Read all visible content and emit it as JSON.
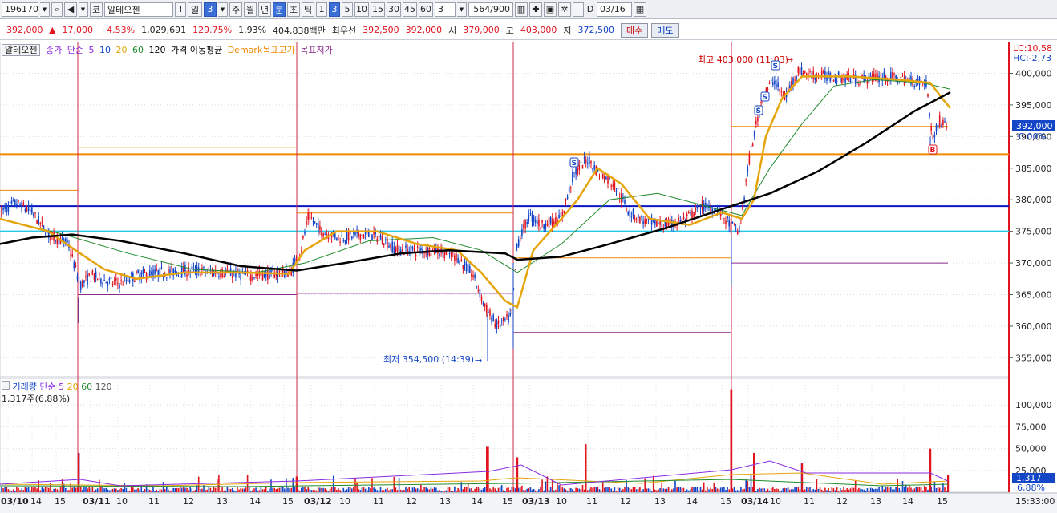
{
  "toolbar": {
    "code": "196170",
    "market": "코",
    "name": "알테오젠",
    "period_day": "일",
    "period_num": "3",
    "period_week": "주",
    "period_month": "월",
    "period_year": "년",
    "period_min": "분",
    "period_sec": "초",
    "period_tick": "틱",
    "intervals": [
      "1",
      "3",
      "5",
      "10",
      "15",
      "30",
      "45",
      "60"
    ],
    "interval_input": "3",
    "count": "564",
    "count_max": "/900",
    "d_label": "D",
    "date": "03/16"
  },
  "quote": {
    "price": "392,000",
    "change": "17,000",
    "change_pct": "+4.53%",
    "volume": "1,029,691",
    "volume_ratio": "129.75%",
    "turnover": "1.93%",
    "amount": "404,838백만",
    "best_label": "최우선",
    "best_ask": "392,500",
    "best_bid": "392,000",
    "open_label": "시",
    "open": "379,000",
    "high_label": "고",
    "high": "403,000",
    "low_label": "저",
    "low": "372,500",
    "buy": "매수",
    "sell": "매도"
  },
  "legend": {
    "name": "알테오젠",
    "close": "종가",
    "simple": "단순",
    "ma": [
      "5",
      "10",
      "20",
      "60",
      "120"
    ],
    "price_ma": "가격 이동평균",
    "demark_high": "Demark목표고가",
    "demark_low": "목표저가"
  },
  "vol_legend": {
    "name": "거래량",
    "simple": "단순",
    "ma": [
      "5",
      "20",
      "60",
      "120"
    ],
    "current": "1,317주(6,88%)"
  },
  "annotations": {
    "high": "최고 403,000 (11:03)",
    "low": "최저 354,500 (14:39)",
    "lc": "LC:10,58",
    "hc": "HC:-2,73",
    "last_price": "392,000",
    "last_pct": "0.00%",
    "vol_last": "1,317",
    "vol_pct": "6,88%",
    "time": "15:33:00"
  },
  "price_axis": [
    "400,000",
    "395,000",
    "390,000",
    "385,000",
    "380,000",
    "375,000",
    "370,000",
    "365,000",
    "360,000",
    "355,000"
  ],
  "volume_axis": [
    "100,000",
    "75,000",
    "50,000",
    "25,000"
  ],
  "time_axis": [
    {
      "label": "03/10",
      "day": true
    },
    {
      "label": "14"
    },
    {
      "label": "15"
    },
    {
      "label": "03/11",
      "day": true
    },
    {
      "label": "10"
    },
    {
      "label": "11"
    },
    {
      "label": "12"
    },
    {
      "label": "13"
    },
    {
      "label": "14"
    },
    {
      "label": "15"
    },
    {
      "label": "03/12",
      "day": true
    },
    {
      "label": "10"
    },
    {
      "label": "11"
    },
    {
      "label": "12"
    },
    {
      "label": "13"
    },
    {
      "label": "14"
    },
    {
      "label": "15"
    },
    {
      "label": "03/13",
      "day": true
    },
    {
      "label": "10"
    },
    {
      "label": "11"
    },
    {
      "label": "12"
    },
    {
      "label": "13"
    },
    {
      "label": "14"
    },
    {
      "label": "15"
    },
    {
      "label": "03/14",
      "day": true
    },
    {
      "label": "10"
    },
    {
      "label": "11"
    },
    {
      "label": "12"
    },
    {
      "label": "13"
    },
    {
      "label": "14"
    },
    {
      "label": "15"
    }
  ],
  "markers": {
    "s": "S",
    "b": "B"
  },
  "chart_data": {
    "type": "candlestick",
    "ylim": [
      352000,
      404500
    ],
    "volume_ylim": [
      0,
      125000
    ],
    "hlines": [
      {
        "value": 387200,
        "color": "#f08a00"
      },
      {
        "value": 379000,
        "color": "#0a14c8"
      },
      {
        "value": 375000,
        "color": "#28c8ea"
      }
    ],
    "path": [
      [
        0,
        378000
      ],
      [
        20,
        379500
      ],
      [
        40,
        378000
      ],
      [
        60,
        374500
      ],
      [
        85,
        373000
      ],
      [
        100,
        366500
      ],
      [
        115,
        368000
      ],
      [
        135,
        367000
      ],
      [
        150,
        366800
      ],
      [
        170,
        368000
      ],
      [
        200,
        368500
      ],
      [
        240,
        368800
      ],
      [
        280,
        368500
      ],
      [
        310,
        368000
      ],
      [
        340,
        368300
      ],
      [
        362,
        368500
      ],
      [
        375,
        372000
      ],
      [
        385,
        377500
      ],
      [
        400,
        375000
      ],
      [
        425,
        374000
      ],
      [
        450,
        374500
      ],
      [
        475,
        374000
      ],
      [
        495,
        372000
      ],
      [
        520,
        372000
      ],
      [
        545,
        372000
      ],
      [
        570,
        371000
      ],
      [
        590,
        368000
      ],
      [
        605,
        363000
      ],
      [
        620,
        360000
      ],
      [
        638,
        361500
      ],
      [
        645,
        373000
      ],
      [
        660,
        377500
      ],
      [
        675,
        376000
      ],
      [
        700,
        377000
      ],
      [
        715,
        384000
      ],
      [
        733,
        386500
      ],
      [
        745,
        384500
      ],
      [
        765,
        382500
      ],
      [
        785,
        378000
      ],
      [
        805,
        376500
      ],
      [
        830,
        376000
      ],
      [
        855,
        376800
      ],
      [
        875,
        379000
      ],
      [
        895,
        378500
      ],
      [
        910,
        376000
      ],
      [
        922,
        375000
      ],
      [
        935,
        387000
      ],
      [
        950,
        396000
      ],
      [
        965,
        399000
      ],
      [
        978,
        396000
      ],
      [
        995,
        400500
      ],
      [
        1010,
        399800
      ],
      [
        1040,
        399500
      ],
      [
        1070,
        399000
      ],
      [
        1100,
        399500
      ],
      [
        1130,
        399000
      ],
      [
        1155,
        398500
      ],
      [
        1163,
        389500
      ],
      [
        1172,
        392500
      ],
      [
        1182,
        392000
      ]
    ],
    "ma_black": [
      [
        0,
        373000
      ],
      [
        40,
        374000
      ],
      [
        90,
        374500
      ],
      [
        150,
        373500
      ],
      [
        230,
        371500
      ],
      [
        300,
        369500
      ],
      [
        370,
        368800
      ],
      [
        430,
        370000
      ],
      [
        500,
        371500
      ],
      [
        560,
        372000
      ],
      [
        630,
        371500
      ],
      [
        645,
        370500
      ],
      [
        700,
        371000
      ],
      [
        760,
        373000
      ],
      [
        830,
        375500
      ],
      [
        900,
        378500
      ],
      [
        960,
        381000
      ],
      [
        1020,
        384500
      ],
      [
        1080,
        389000
      ],
      [
        1140,
        394000
      ],
      [
        1170,
        396000
      ],
      [
        1185,
        397000
      ]
    ],
    "ma_orange": [
      [
        0,
        377000
      ],
      [
        60,
        375000
      ],
      [
        100,
        371500
      ],
      [
        130,
        369000
      ],
      [
        170,
        367500
      ],
      [
        230,
        368500
      ],
      [
        300,
        368500
      ],
      [
        360,
        368300
      ],
      [
        380,
        372000
      ],
      [
        420,
        375000
      ],
      [
        470,
        375000
      ],
      [
        520,
        373000
      ],
      [
        570,
        372000
      ],
      [
        600,
        368500
      ],
      [
        630,
        364000
      ],
      [
        645,
        363000
      ],
      [
        665,
        372000
      ],
      [
        700,
        377000
      ],
      [
        720,
        380000
      ],
      [
        745,
        385000
      ],
      [
        775,
        382500
      ],
      [
        810,
        377000
      ],
      [
        860,
        376000
      ],
      [
        900,
        378000
      ],
      [
        925,
        377000
      ],
      [
        940,
        380000
      ],
      [
        955,
        390000
      ],
      [
        975,
        396000
      ],
      [
        1000,
        399500
      ],
      [
        1060,
        399500
      ],
      [
        1120,
        399000
      ],
      [
        1160,
        398500
      ],
      [
        1175,
        396000
      ],
      [
        1185,
        394500
      ]
    ],
    "ma_green": [
      [
        0,
        377000
      ],
      [
        80,
        374500
      ],
      [
        160,
        371500
      ],
      [
        240,
        369000
      ],
      [
        320,
        368500
      ],
      [
        380,
        370000
      ],
      [
        460,
        373500
      ],
      [
        540,
        374000
      ],
      [
        600,
        372000
      ],
      [
        645,
        368500
      ],
      [
        700,
        373000
      ],
      [
        760,
        380000
      ],
      [
        820,
        381000
      ],
      [
        880,
        379000
      ],
      [
        925,
        377500
      ],
      [
        960,
        385000
      ],
      [
        1000,
        392000
      ],
      [
        1040,
        398000
      ],
      [
        1090,
        399000
      ],
      [
        1150,
        398500
      ],
      [
        1185,
        397500
      ]
    ],
    "demark_high": [
      [
        0,
        381500
      ],
      [
        97,
        381500
      ],
      [
        97,
        388300
      ],
      [
        370,
        388300
      ],
      [
        370,
        377900
      ],
      [
        640,
        377900
      ],
      [
        640,
        370800
      ],
      [
        912,
        370800
      ],
      [
        912,
        391600
      ],
      [
        1182,
        391600
      ]
    ],
    "demark_low": [
      [
        97,
        365000
      ],
      [
        370,
        365000
      ],
      [
        370,
        365200
      ],
      [
        640,
        365200
      ],
      [
        640,
        359000
      ],
      [
        912,
        359000
      ],
      [
        912,
        370000
      ],
      [
        1182,
        370000
      ]
    ],
    "day_lines": [
      97,
      370,
      640,
      912
    ],
    "volume_spikes": [
      [
        98,
        45000
      ],
      [
        370,
        18000
      ],
      [
        608,
        52000
      ],
      [
        645,
        40000
      ],
      [
        730,
        55000
      ],
      [
        912,
        118000
      ],
      [
        940,
        45000
      ],
      [
        1000,
        33000
      ],
      [
        1160,
        50000
      ],
      [
        1182,
        20000
      ]
    ]
  }
}
